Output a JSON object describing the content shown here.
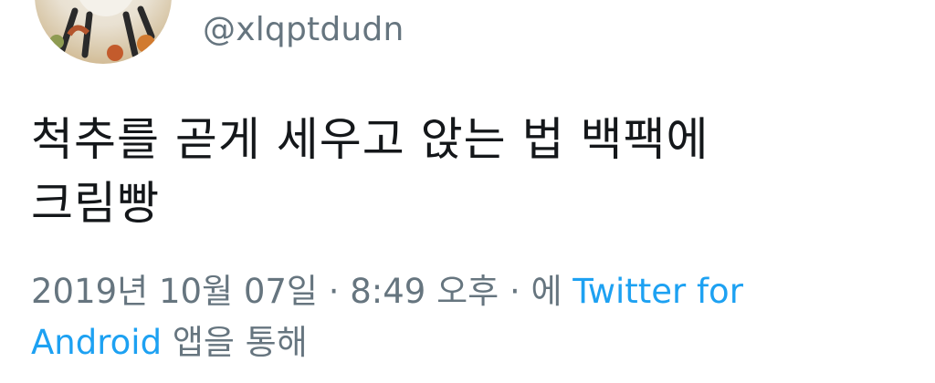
{
  "user": {
    "handle": "@xlqptdudn"
  },
  "tweet": {
    "line1": "척추를 곧게 세우고 앉는 법 백팩에",
    "line2": "크림빵"
  },
  "meta": {
    "timestamp": "2019년 10월 07일 · 8:49 오후 · 에 ",
    "source_link": "Twitter for Android",
    "suffix": " 앱을 통해"
  },
  "colors": {
    "text": "#14171a",
    "secondary": "#66757f",
    "link": "#1da1f2"
  }
}
